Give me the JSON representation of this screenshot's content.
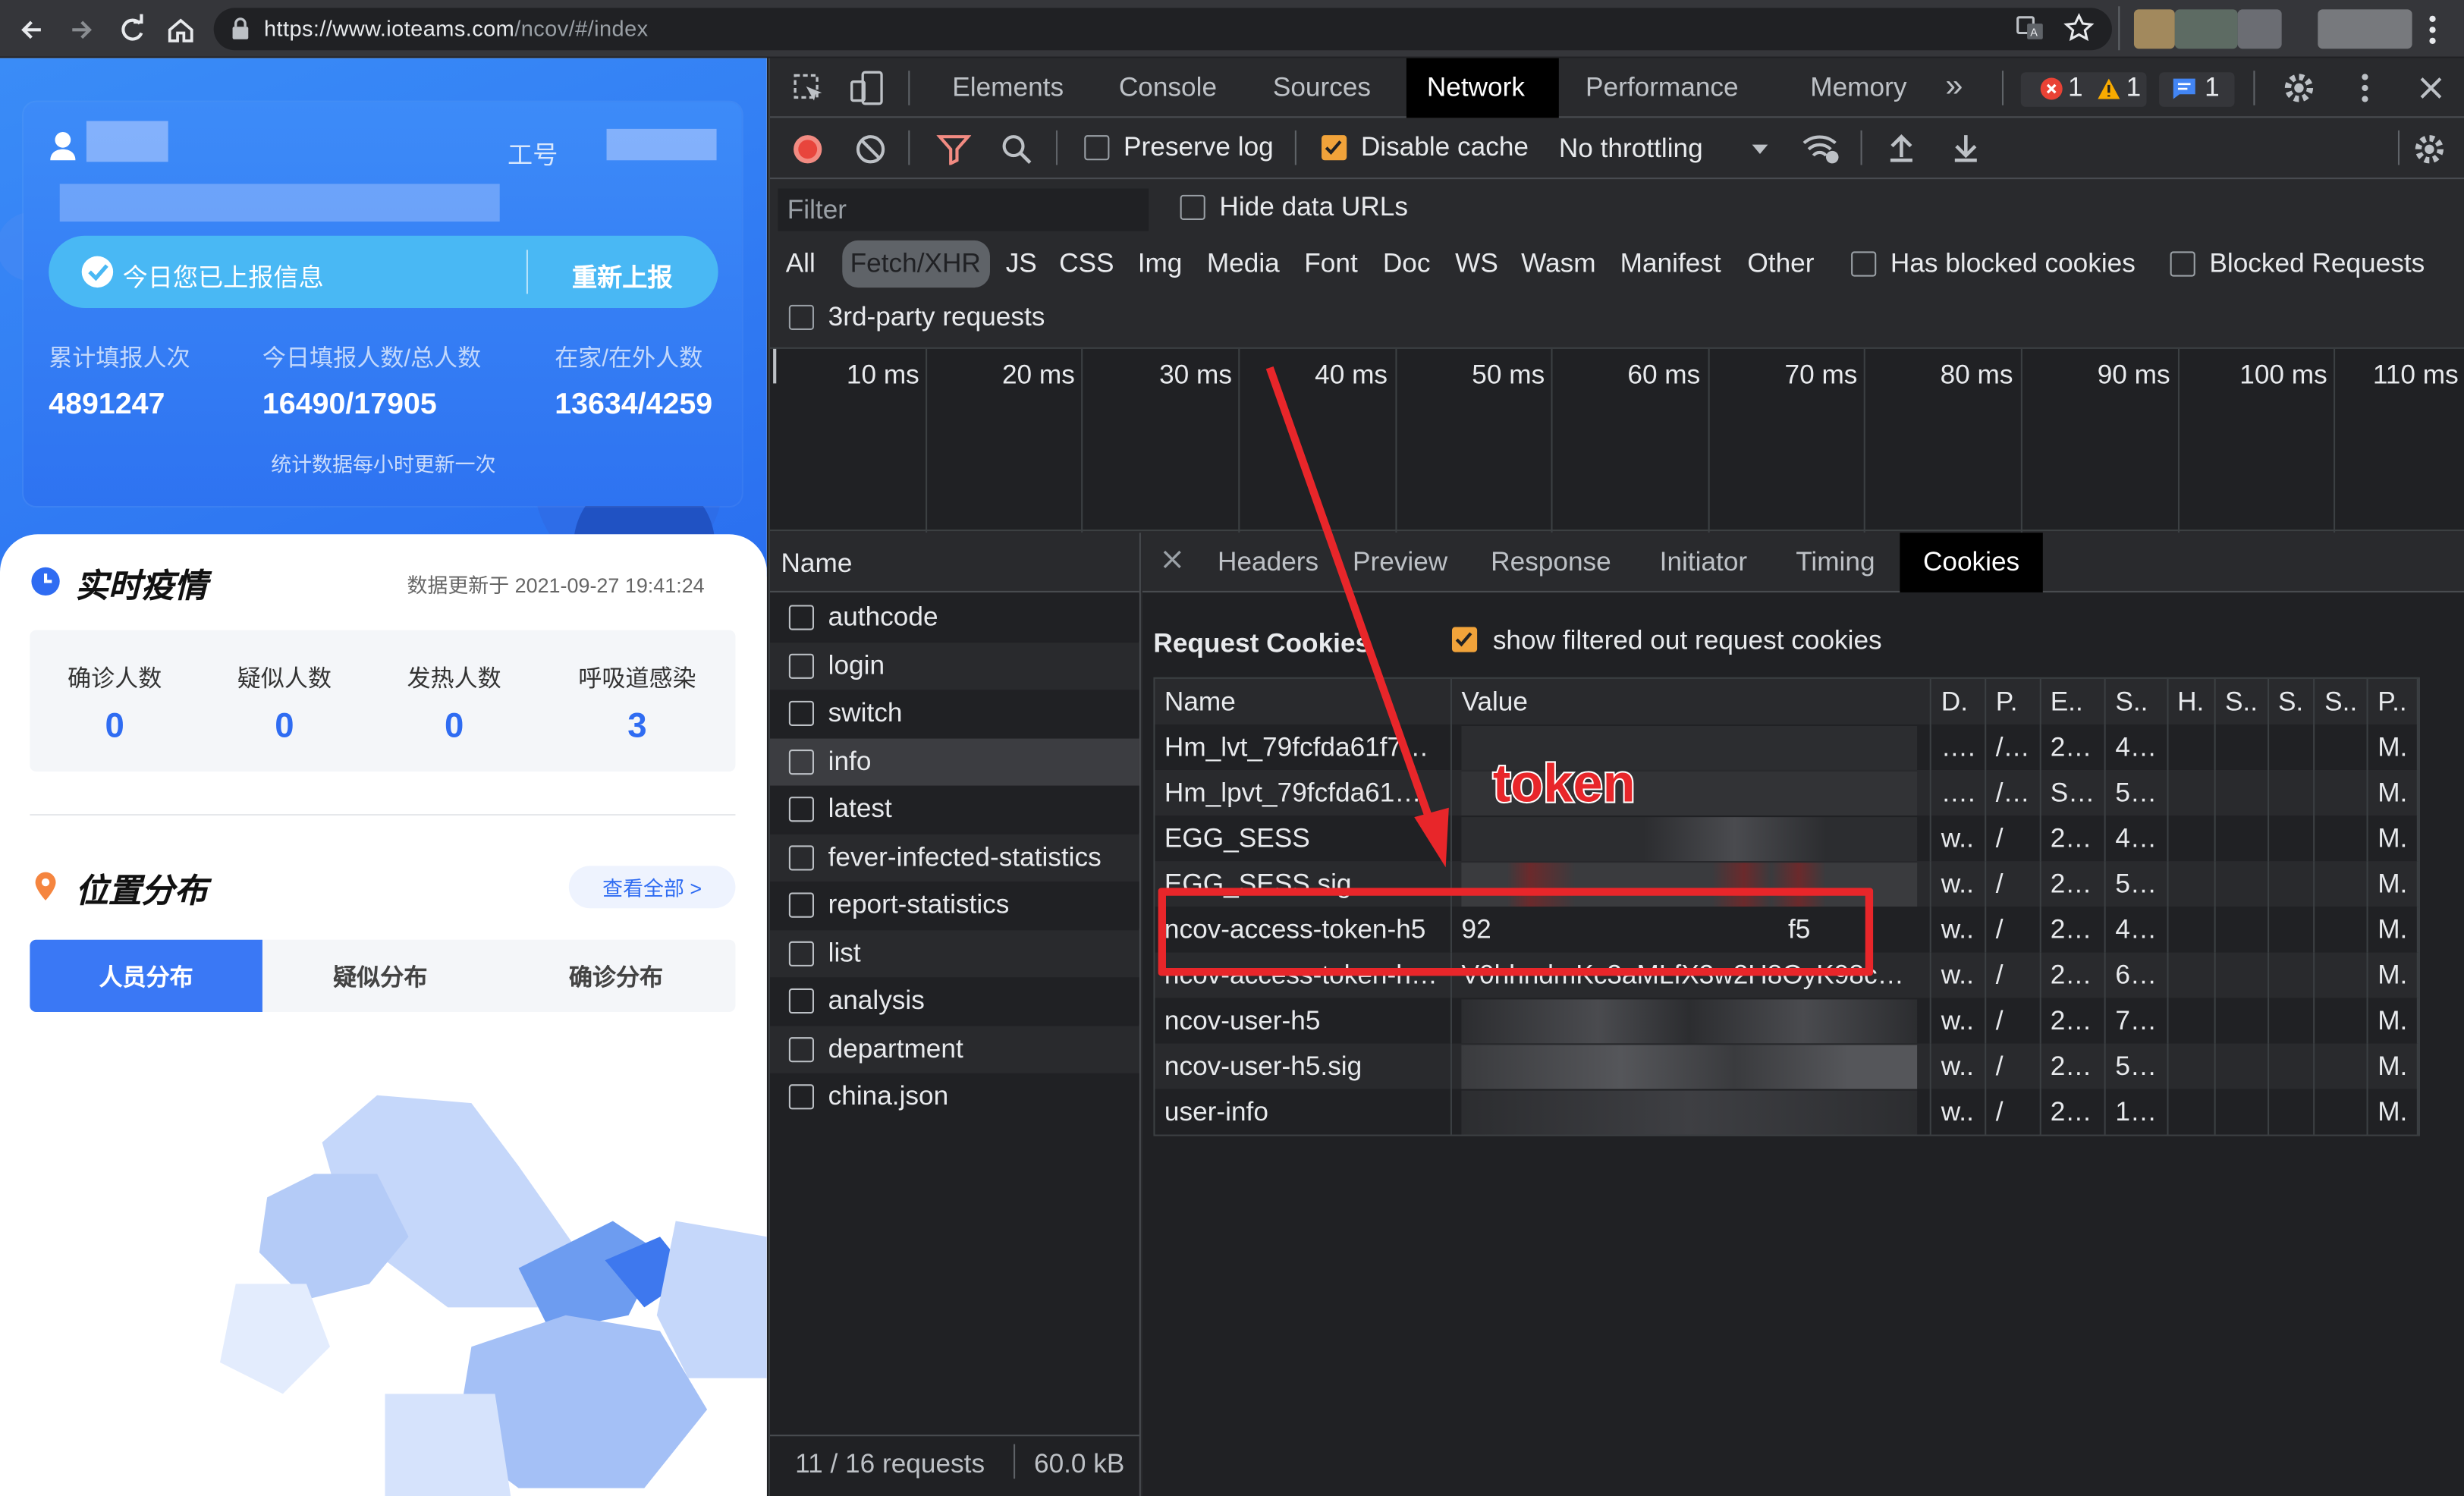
{
  "browser": {
    "url_host": "https://www.ioteams.com",
    "url_path": "/ncov/#/index"
  },
  "app": {
    "employee_id_label": "工号",
    "report_status": "今日您已上报信息",
    "re_report": "重新上报",
    "stats": [
      {
        "label": "累计填报人次",
        "value": "4891247"
      },
      {
        "label": "今日填报人数/总人数",
        "value": "16490/17905"
      },
      {
        "label": "在家/在外人数",
        "value": "13634/4259"
      }
    ],
    "stats_note": "统计数据每小时更新一次",
    "realtime_title": "实时疫情",
    "realtime_updated": "数据更新于 2021-09-27 19:41:24",
    "counters": [
      {
        "label": "确诊人数",
        "value": "0"
      },
      {
        "label": "疑似人数",
        "value": "0"
      },
      {
        "label": "发热人数",
        "value": "0"
      },
      {
        "label": "呼吸道感染",
        "value": "3"
      }
    ],
    "distribution_title": "位置分布",
    "view_all": "查看全部 >",
    "dist_tabs": [
      "人员分布",
      "疑似分布",
      "确诊分布"
    ]
  },
  "devtools": {
    "tabs": [
      "Elements",
      "Console",
      "Sources",
      "Network",
      "Performance",
      "Memory"
    ],
    "active_tab": "Network",
    "badges": {
      "errors": "1",
      "warnings": "1",
      "messages": "1"
    },
    "preserve_log": "Preserve log",
    "disable_cache": "Disable cache",
    "throttling": "No throttling",
    "filter_placeholder": "Filter",
    "hide_data_urls": "Hide data URLs",
    "type_filters": [
      "All",
      "Fetch/XHR",
      "JS",
      "CSS",
      "Img",
      "Media",
      "Font",
      "Doc",
      "WS",
      "Wasm",
      "Manifest",
      "Other"
    ],
    "has_blocked_cookies": "Has blocked cookies",
    "blocked_requests": "Blocked Requests",
    "third_party": "3rd-party requests",
    "timeline_ticks": [
      "10 ms",
      "20 ms",
      "30 ms",
      "40 ms",
      "50 ms",
      "60 ms",
      "70 ms",
      "80 ms",
      "90 ms",
      "100 ms",
      "110 ms"
    ],
    "name_header": "Name",
    "requests": [
      "authcode",
      "login",
      "switch",
      "info",
      "latest",
      "fever-infected-statistics",
      "report-statistics",
      "list",
      "analysis",
      "department",
      "china.json"
    ],
    "selected_request": "info",
    "summary_requests": "11 / 16 requests",
    "summary_size": "60.0 kB",
    "detail_tabs": [
      "Headers",
      "Preview",
      "Response",
      "Initiator",
      "Timing",
      "Cookies"
    ],
    "active_detail_tab": "Cookies",
    "request_cookies_title": "Request Cookies",
    "show_filtered": "show filtered out request cookies",
    "cookie_headers": [
      "Name",
      "Value",
      "D.",
      "P.",
      "E..",
      "S..",
      "H.",
      "S..",
      "S.",
      "S..",
      "P.."
    ],
    "cookies": [
      {
        "name": "Hm_lvt_79fcfda61f7…",
        "value": "",
        "d": "….",
        "p": "/…",
        "e": "2…",
        "s": "4…",
        "pr": "M."
      },
      {
        "name": "Hm_lpvt_79fcfda61…",
        "value": "",
        "d": "….",
        "p": "/…",
        "e": "S…",
        "s": "5…",
        "pr": "M."
      },
      {
        "name": "EGG_SESS",
        "value": "",
        "d": "w..",
        "p": "/",
        "e": "2…",
        "s": "4…",
        "pr": "M."
      },
      {
        "name": "EGG_SESS.sig",
        "value": "",
        "d": "w..",
        "p": "/",
        "e": "2…",
        "s": "5…",
        "pr": "M."
      },
      {
        "name": "ncov-access-token-h5",
        "value": "92                                        f5",
        "d": "w..",
        "p": "/",
        "e": "2…",
        "s": "4…",
        "pr": "M."
      },
      {
        "name": "ncov-access-token-h…",
        "value": "V0hhndmKc3aMLfX3w2H8OyK98c…",
        "d": "w..",
        "p": "/",
        "e": "2…",
        "s": "6…",
        "pr": "M."
      },
      {
        "name": "ncov-user-h5",
        "value": "",
        "d": "w..",
        "p": "/",
        "e": "2…",
        "s": "7…",
        "pr": "M."
      },
      {
        "name": "ncov-user-h5.sig",
        "value": "",
        "d": "w..",
        "p": "/",
        "e": "2…",
        "s": "5…",
        "pr": "M."
      },
      {
        "name": "user-info",
        "value": "",
        "d": "w..",
        "p": "/",
        "e": "2…",
        "s": "1…",
        "pr": "M."
      }
    ]
  },
  "annotation": {
    "label": "token",
    "color": "#e8262a"
  }
}
